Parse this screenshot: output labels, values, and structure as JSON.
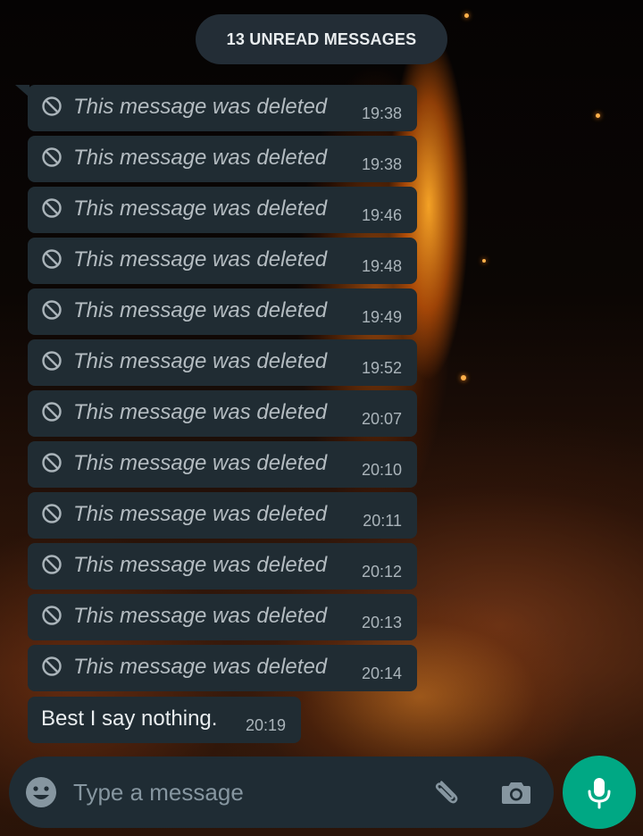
{
  "chat": {
    "unread_banner": "13 UNREAD MESSAGES",
    "deleted_messages": [
      {
        "text": "This message was deleted",
        "time": "19:38"
      },
      {
        "text": "This message was deleted",
        "time": "19:38"
      },
      {
        "text": "This message was deleted",
        "time": "19:46"
      },
      {
        "text": "This message was deleted",
        "time": "19:48"
      },
      {
        "text": "This message was deleted",
        "time": "19:49"
      },
      {
        "text": "This message was deleted",
        "time": "19:52"
      },
      {
        "text": "This message was deleted",
        "time": "20:07"
      },
      {
        "text": "This message was deleted",
        "time": "20:10"
      },
      {
        "text": "This message was deleted",
        "time": "20:11"
      },
      {
        "text": "This message was deleted",
        "time": "20:12"
      },
      {
        "text": "This message was deleted",
        "time": "20:13"
      },
      {
        "text": "This message was deleted",
        "time": "20:14"
      }
    ],
    "last_message": {
      "text": "Best I say nothing.",
      "time": "20:19"
    }
  },
  "composer": {
    "placeholder": "Type a message",
    "value": ""
  },
  "icons": {
    "deleted": "ban-icon",
    "emoji": "smiley-icon",
    "attach": "paperclip-icon",
    "camera": "camera-icon",
    "voice": "microphone-icon"
  },
  "colors": {
    "bubble": "#202c33",
    "composer": "#1f2c34",
    "accent": "#00a884",
    "banner": "#232d36"
  }
}
